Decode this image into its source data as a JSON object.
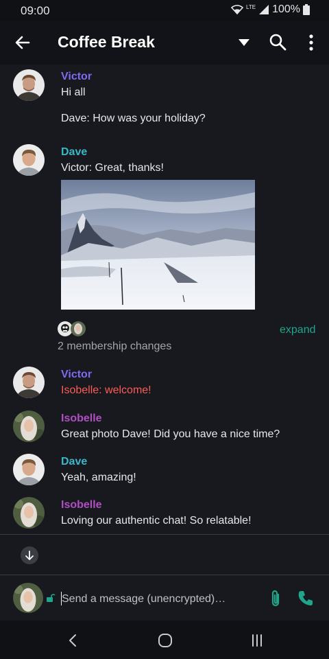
{
  "status_bar": {
    "time": "09:00",
    "network": "LTE",
    "battery": "100%"
  },
  "app_bar": {
    "title": "Coffee Break",
    "icons": [
      "back-arrow-icon",
      "dropdown-icon",
      "search-icon",
      "more-icon"
    ]
  },
  "messages": [
    {
      "sender": "Victor",
      "lines": [
        "Hi all",
        "Dave: How was your holiday?"
      ]
    },
    {
      "sender": "Dave",
      "lines": [
        "Victor: Great, thanks!"
      ],
      "has_image": true
    },
    {
      "sender": "Victor",
      "lines": [
        "Isobelle: welcome!"
      ]
    },
    {
      "sender": "Isobelle",
      "lines": [
        "Great photo Dave! Did you have a nice time?"
      ]
    },
    {
      "sender": "Dave",
      "lines": [
        "Yeah, amazing!"
      ]
    },
    {
      "sender": "Isobelle",
      "lines": [
        "Loving our authentic chat! So relatable!"
      ]
    }
  ],
  "membership": {
    "summary": "2 membership changes",
    "expand_label": "expand"
  },
  "composer": {
    "placeholder": "Send a message (unencrypted)…"
  },
  "colors": {
    "victor": "#7b6cf0",
    "dave": "#3bb8c8",
    "isobelle": "#b14fc2",
    "accent": "#1fa58a",
    "mention_red": "#ff5b55",
    "background": "#17191f"
  }
}
